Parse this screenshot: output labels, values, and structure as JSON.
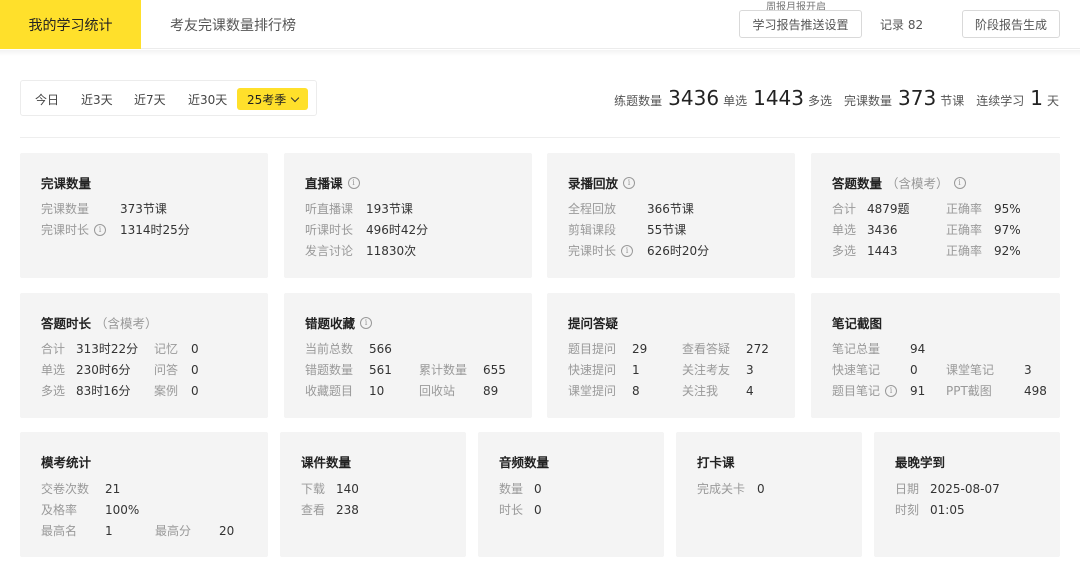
{
  "header": {
    "tab_active": "我的学习统计",
    "tab_rank": "考友完课数量排行榜",
    "weekly_tag": "周报月报开启",
    "push_button": "学习报告推送设置",
    "record": "记录 82",
    "stage_button": "阶段报告生成"
  },
  "filters": {
    "items": [
      "今日",
      "近3天",
      "近7天",
      "近30天"
    ],
    "active": "25考季"
  },
  "summary": {
    "practice_label": "练题数量",
    "practice_value": "3436",
    "single_label": "单选",
    "single_value": "1443",
    "multi_label": "多选",
    "complete_label": "完课数量",
    "complete_value": "373",
    "lesson_unit": "节课",
    "streak_label": "连续学习",
    "streak_value": "1",
    "day_unit": "天"
  },
  "cards": {
    "complete": {
      "title": "完课数量",
      "rows": [
        {
          "label": "完课数量",
          "value": "373节课"
        },
        {
          "label": "完课时长",
          "value": "1314时25分"
        }
      ]
    },
    "live": {
      "title": "直播课",
      "rows": [
        {
          "label": "听直播课",
          "value": "193节课"
        },
        {
          "label": "听课时长",
          "value": "496时42分"
        },
        {
          "label": "发言讨论",
          "value": "11830次"
        }
      ]
    },
    "replay": {
      "title": "录播回放",
      "rows": [
        {
          "label": "全程回放",
          "value": "366节课"
        },
        {
          "label": "剪辑课段",
          "value": "55节课"
        },
        {
          "label": "完课时长",
          "value": "626时20分"
        }
      ]
    },
    "answers": {
      "title": "答题数量",
      "sub": "（含模考）",
      "rows": [
        {
          "label": "合计",
          "value": "4879题",
          "label2": "正确率",
          "value2": "95%"
        },
        {
          "label": "单选",
          "value": "3436",
          "label2": "正确率",
          "value2": "97%"
        },
        {
          "label": "多选",
          "value": "1443",
          "label2": "正确率",
          "value2": "92%"
        }
      ]
    },
    "answer_time": {
      "title": "答题时长",
      "sub": "（含模考）",
      "rows": [
        {
          "label": "合计",
          "value": "313时22分",
          "label2": "记忆",
          "value2": "0"
        },
        {
          "label": "单选",
          "value": "230时6分",
          "label2": "问答",
          "value2": "0"
        },
        {
          "label": "多选",
          "value": "83时16分",
          "label2": "案例",
          "value2": "0"
        }
      ]
    },
    "wrong": {
      "title": "错题收藏",
      "rows": [
        {
          "label": "当前总数",
          "value": "566"
        },
        {
          "label": "错题数量",
          "value": "561",
          "label2": "累计数量",
          "value2": "655"
        },
        {
          "label": "收藏题目",
          "value": "10",
          "label2": "回收站",
          "value2": "89"
        }
      ]
    },
    "questions": {
      "title": "提问答疑",
      "rows": [
        {
          "label": "题目提问",
          "value": "29",
          "label2": "查看答疑",
          "value2": "272"
        },
        {
          "label": "快速提问",
          "value": "1",
          "label2": "关注考友",
          "value2": "3"
        },
        {
          "label": "课堂提问",
          "value": "8",
          "label2": "关注我",
          "value2": "4"
        }
      ]
    },
    "notes": {
      "title": "笔记截图",
      "rows": [
        {
          "label": "笔记总量",
          "value": "94"
        },
        {
          "label": "快速笔记",
          "value": "0",
          "label2": "课堂笔记",
          "value2": "3"
        },
        {
          "label": "题目笔记",
          "value": "91",
          "label2": "PPT截图",
          "value2": "498"
        }
      ]
    },
    "mock": {
      "title": "模考统计",
      "rows": [
        {
          "label": "交卷次数",
          "value": "21"
        },
        {
          "label": "及格率",
          "value": "100%"
        },
        {
          "label": "最高名",
          "value": "1",
          "label2": "最高分",
          "value2": "20"
        }
      ]
    },
    "courseware": {
      "title": "课件数量",
      "rows": [
        {
          "label": "下载",
          "value": "140"
        },
        {
          "label": "查看",
          "value": "238"
        }
      ]
    },
    "audio": {
      "title": "音频数量",
      "rows": [
        {
          "label": "数量",
          "value": "0"
        },
        {
          "label": "时长",
          "value": "0"
        }
      ]
    },
    "checkin": {
      "title": "打卡课",
      "rows": [
        {
          "label": "完成关卡",
          "value": "0"
        }
      ]
    },
    "latest": {
      "title": "最晚学到",
      "rows": [
        {
          "label": "日期",
          "value": "2025-08-07"
        },
        {
          "label": "时刻",
          "value": "01:05"
        }
      ]
    }
  }
}
